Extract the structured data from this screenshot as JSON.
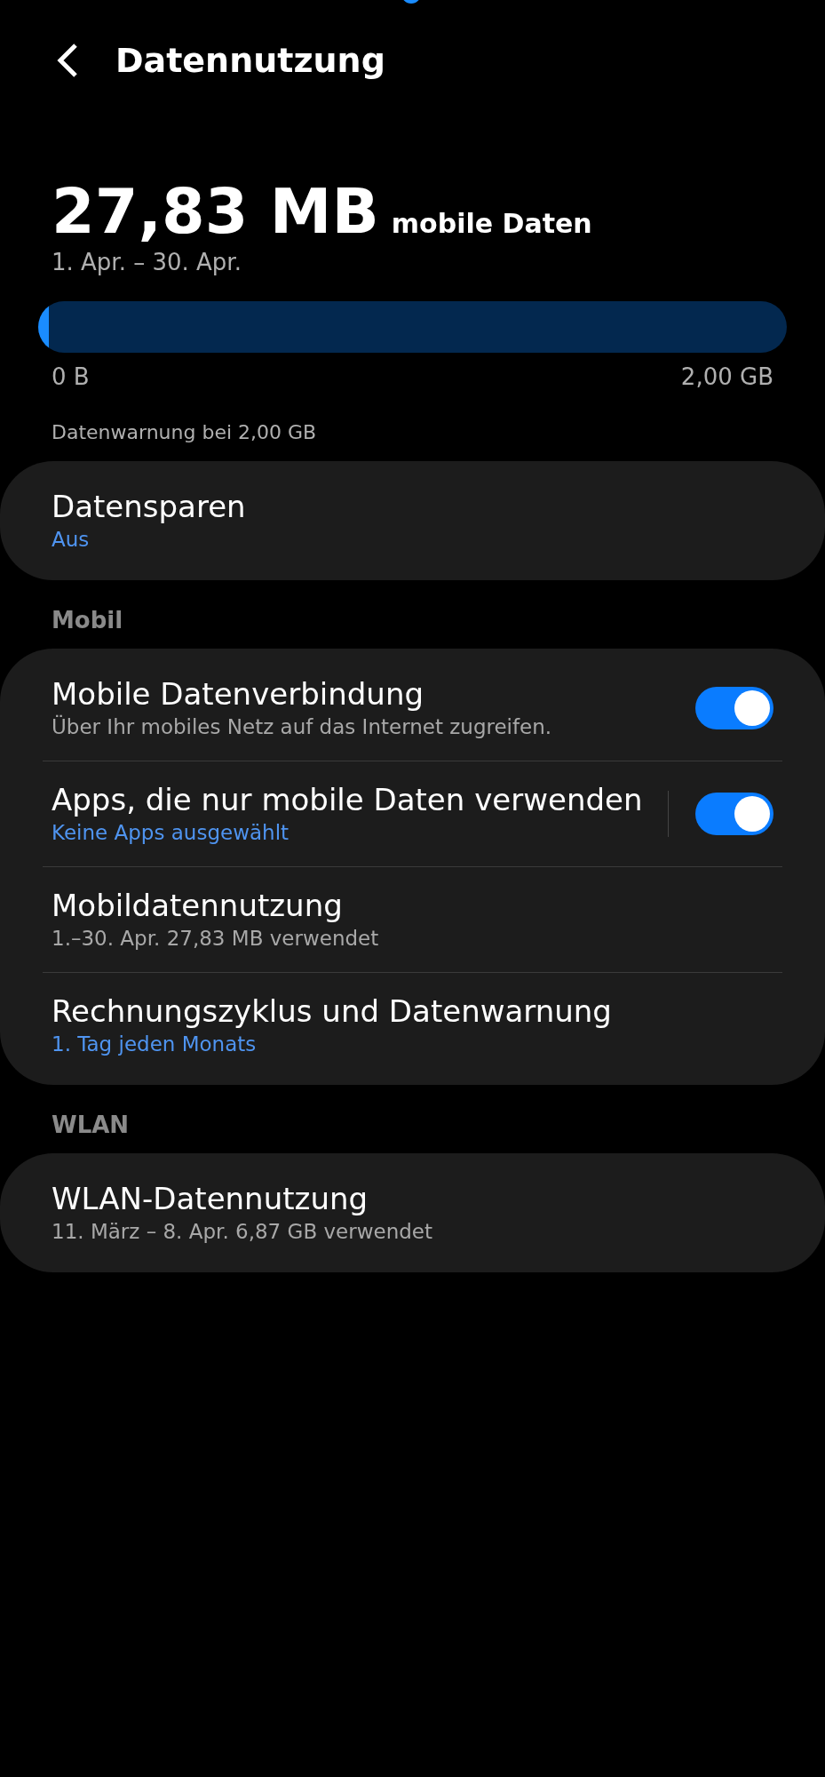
{
  "header": {
    "title": "Datennutzung"
  },
  "usage": {
    "amount": "27,83 MB",
    "unit": "mobile Daten",
    "period": "1. Apr. – 30. Apr.",
    "level": 0.014,
    "min_label": "0 B",
    "max_label": "2,00 GB",
    "warning": "Datenwarnung bei 2,00 GB"
  },
  "sections": [
    {
      "items": [
        {
          "kind": "link",
          "title": "Datensparen",
          "subtitle": "Aus",
          "accent": true
        }
      ]
    },
    {
      "heading": "Mobil",
      "items": [
        {
          "kind": "toggle",
          "title": "Mobile Datenverbindung",
          "subtitle": "Über Ihr mobiles Netz auf das Internet zugreifen.",
          "accent": false,
          "on": true,
          "divider": false
        },
        {
          "kind": "toggle",
          "title": "Apps, die nur mobile Daten verwenden",
          "subtitle": "Keine Apps ausgewählt",
          "accent": true,
          "on": true,
          "divider": true
        },
        {
          "kind": "link",
          "title": "Mobildatennutzung",
          "subtitle": "1.–30. Apr. 27,83 MB verwendet",
          "accent": false
        },
        {
          "kind": "link",
          "title": "Rechnungszyklus und Datenwarnung",
          "subtitle": "1. Tag jeden Monats",
          "accent": true
        }
      ]
    },
    {
      "heading": "WLAN",
      "items": [
        {
          "kind": "link",
          "title": "WLAN-Datennutzung",
          "subtitle": "11. März – 8. Apr. 6,87 GB verwendet",
          "accent": false
        }
      ]
    }
  ]
}
